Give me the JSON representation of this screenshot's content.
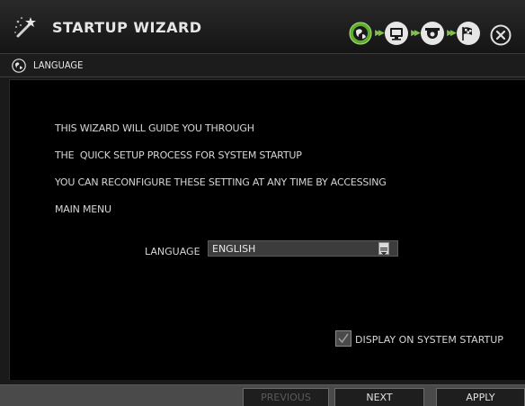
{
  "header": {
    "title": "STARTUP WIZARD",
    "steps": [
      {
        "name": "language",
        "icon": "globe-icon",
        "active": true
      },
      {
        "name": "display",
        "icon": "monitor-icon",
        "active": false
      },
      {
        "name": "camera",
        "icon": "camera-icon",
        "active": false
      },
      {
        "name": "finish",
        "icon": "checkered-flag-icon",
        "active": false
      }
    ],
    "close_icon": "close-icon"
  },
  "section": {
    "title": "LANGUAGE",
    "icon": "globe-icon"
  },
  "intro": {
    "lines": [
      "THIS WIZARD WILL GUIDE YOU THROUGH",
      "THE  QUICK SETUP PROCESS FOR SYSTEM STARTUP",
      "YOU CAN RECONFIGURE THESE SETTING AT ANY TIME BY ACCESSING",
      "MAIN MENU"
    ]
  },
  "language": {
    "label": "LANGUAGE",
    "value": "ENGLISH"
  },
  "startup": {
    "label": "DISPLAY ON SYSTEM STARTUP",
    "checked": true
  },
  "buttons": {
    "previous": "PREVIOUS",
    "next": "NEXT",
    "apply": "APPLY"
  },
  "colors": {
    "accent_green": "#7fc04a",
    "background": "#000000"
  }
}
